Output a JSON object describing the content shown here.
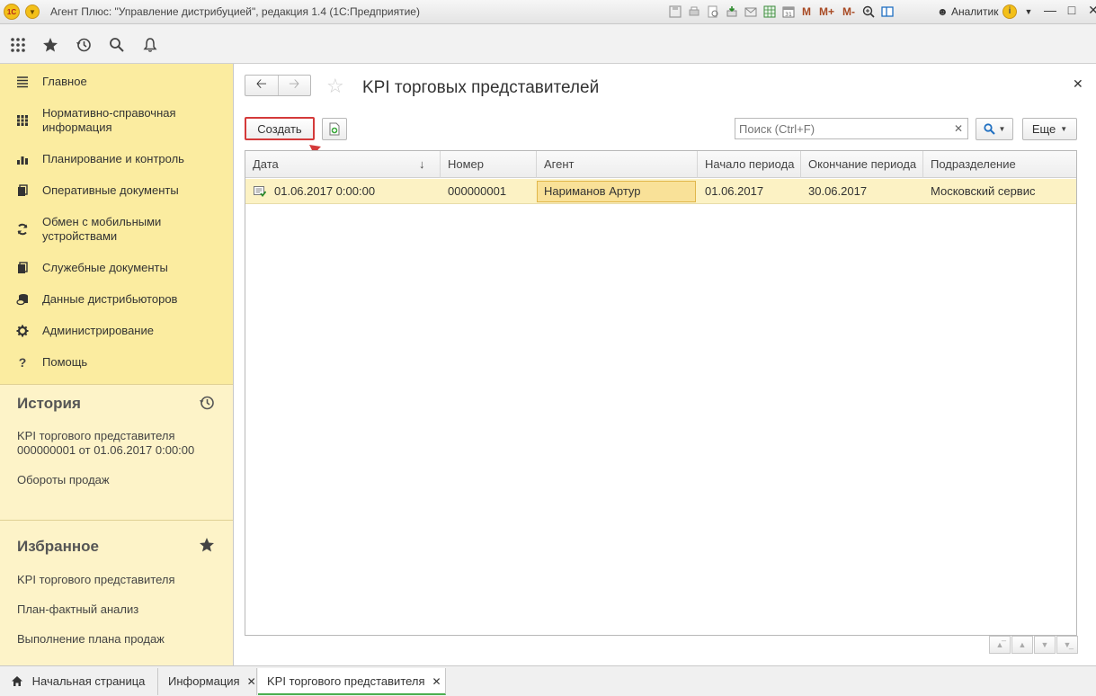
{
  "window": {
    "title": "Агент Плюс: \"Управление дистрибуцией\", редакция 1.4  (1С:Предприятие)",
    "logo": "1С",
    "user": "Аналитик",
    "toolbar_m": [
      "M",
      "M+",
      "M-"
    ]
  },
  "sidebar": {
    "items": [
      {
        "label": "Главное",
        "icon": "menu-lines-icon"
      },
      {
        "label": "Нормативно-справочная информация",
        "icon": "grid-bars-icon"
      },
      {
        "label": "Планирование и контроль",
        "icon": "bar-chart-icon"
      },
      {
        "label": "Оперативные документы",
        "icon": "documents-icon"
      },
      {
        "label": "Обмен с мобильными устройствами",
        "icon": "sync-icon"
      },
      {
        "label": "Служебные документы",
        "icon": "documents-icon"
      },
      {
        "label": "Данные дистрибьюторов",
        "icon": "database-icon"
      },
      {
        "label": "Администрирование",
        "icon": "gear-icon"
      },
      {
        "label": "Помощь",
        "icon": "question-icon"
      }
    ]
  },
  "history": {
    "title": "История",
    "links": [
      "KPI торгового представителя 000000001 от 01.06.2017 0:00:00",
      "Обороты продаж"
    ]
  },
  "favorites": {
    "title": "Избранное",
    "links": [
      "KPI торгового представителя",
      "План-фактный анализ",
      "Выполнение плана продаж"
    ]
  },
  "form": {
    "title": "KPI торговых представителей",
    "create_label": "Создать",
    "search_placeholder": "Поиск (Ctrl+F)",
    "more_label": "Еще",
    "columns": [
      "Дата",
      "Номер",
      "Агент",
      "Начало периода",
      "Окончание периода",
      "Подразделение"
    ],
    "rows": [
      {
        "date": "01.06.2017 0:00:00",
        "number": "000000001",
        "agent": "Нариманов Артур",
        "period_start": "01.06.2017",
        "period_end": "30.06.2017",
        "division": "Московский сервис"
      }
    ]
  },
  "tabs": [
    {
      "label": "Начальная страница"
    },
    {
      "label": "Информация"
    },
    {
      "label": "KPI торгового представителя"
    }
  ],
  "colors": {
    "sidebar_bg": "#fbeca0",
    "selected_row": "#fcf2c4",
    "highlight_border": "#d43a3a",
    "active_tab": "#4caf50"
  }
}
